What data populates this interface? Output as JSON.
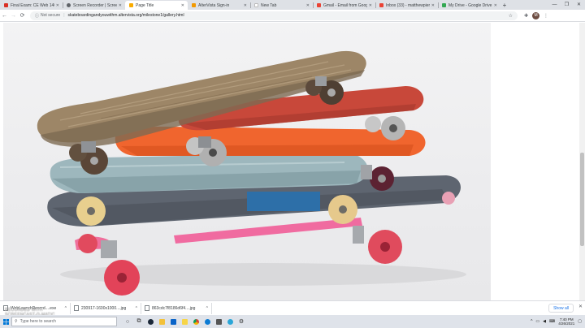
{
  "browser": {
    "tabs": [
      {
        "title": "Final Exam: CE Web 1400",
        "favicon_color": "#d93025"
      },
      {
        "title": "Screen Recorder | Screencast",
        "favicon_color": "#5f6368"
      },
      {
        "title": "Page Title",
        "favicon_color": "#f9ab00",
        "active": true
      },
      {
        "title": "AlterVista Sign-in",
        "favicon_color": "#f29900"
      },
      {
        "title": "New Tab",
        "favicon_color": "#ffffff"
      },
      {
        "title": "Gmail - Email from Google",
        "favicon_color": "#ea4335"
      },
      {
        "title": "Inbox (33) - matthewpierce",
        "favicon_color": "#ea4335"
      },
      {
        "title": "My Drive - Google Drive",
        "favicon_color": "#34a853"
      }
    ],
    "new_tab_label": "+",
    "address_bar": {
      "security_label": "Not secure",
      "url": "skateboardingandyouwithm.altervista.org/milestone1/gallery.html"
    },
    "profile_initial": "M"
  },
  "page": {
    "image_subject": "stack of vintage skateboards"
  },
  "downloads": {
    "items": [
      {
        "name": "WebLaunchRecord....exe"
      },
      {
        "name": "230917-1600x1000....jpg"
      },
      {
        "name": "863cdc7f8186d6f4....jpg"
      }
    ],
    "show_all_label": "Show all"
  },
  "taskbar": {
    "search_placeholder": "Type here to search",
    "clock_time": "7:40 PM",
    "clock_date": "4/26/2021"
  },
  "watermark": {
    "line1": "RECORDED WITH",
    "line2": "SCREENCAST-O-MATIC"
  }
}
